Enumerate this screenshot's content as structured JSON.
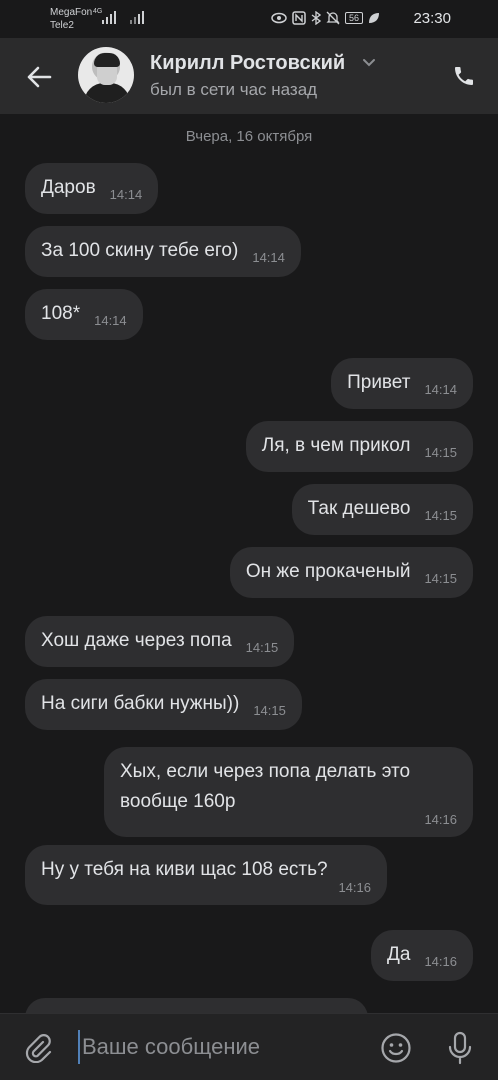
{
  "status_bar": {
    "carrier_1": "MegaFon",
    "carrier_2": "Tele2",
    "network_type": "4G",
    "battery": "56",
    "time": "23:30"
  },
  "header": {
    "contact_name": "Кирилл Ростовский",
    "contact_status": "был в сети час назад"
  },
  "chat": {
    "date_separator": "Вчера, 16 октября",
    "messages": [
      {
        "side": "in",
        "text": "Даров",
        "time": "14:14"
      },
      {
        "side": "in",
        "text": "За 100 скину тебе его)",
        "time": "14:14"
      },
      {
        "side": "in",
        "text": "108*",
        "time": "14:14"
      },
      {
        "side": "out",
        "text": "Привет",
        "time": "14:14"
      },
      {
        "side": "out",
        "text": "Ля, в чем прикол",
        "time": "14:15"
      },
      {
        "side": "out",
        "text": "Так дешево",
        "time": "14:15"
      },
      {
        "side": "out",
        "text": "Он же прокаченый",
        "time": "14:15"
      },
      {
        "side": "in",
        "text": "Хош даже через попа",
        "time": "14:15"
      },
      {
        "side": "in",
        "text": "На сиги бабки нужны))",
        "time": "14:15"
      },
      {
        "side": "out",
        "text": "Хых, если через попа делать это вообще 160р",
        "time": "14:16"
      },
      {
        "side": "in",
        "text": "Ну у тебя на киви щас 108 есть?",
        "time": "14:16"
      },
      {
        "side": "out",
        "text": "Да",
        "time": "14:16"
      },
      {
        "side": "in",
        "text": "",
        "time": ""
      }
    ]
  },
  "input": {
    "placeholder": "Ваше сообщение",
    "value": ""
  },
  "icons": {
    "back": "arrow-left-icon",
    "call": "phone-icon",
    "expand": "chevron-down-icon",
    "attach": "paperclip-icon",
    "emoji": "smiley-icon",
    "mic": "microphone-icon"
  },
  "colors": {
    "background": "#19191a",
    "header": "#2b2b2c",
    "bubble": "#2e2e30",
    "text": "#e1e3e6",
    "secondary_text": "#8c8e92",
    "cursor": "#5181b8"
  }
}
